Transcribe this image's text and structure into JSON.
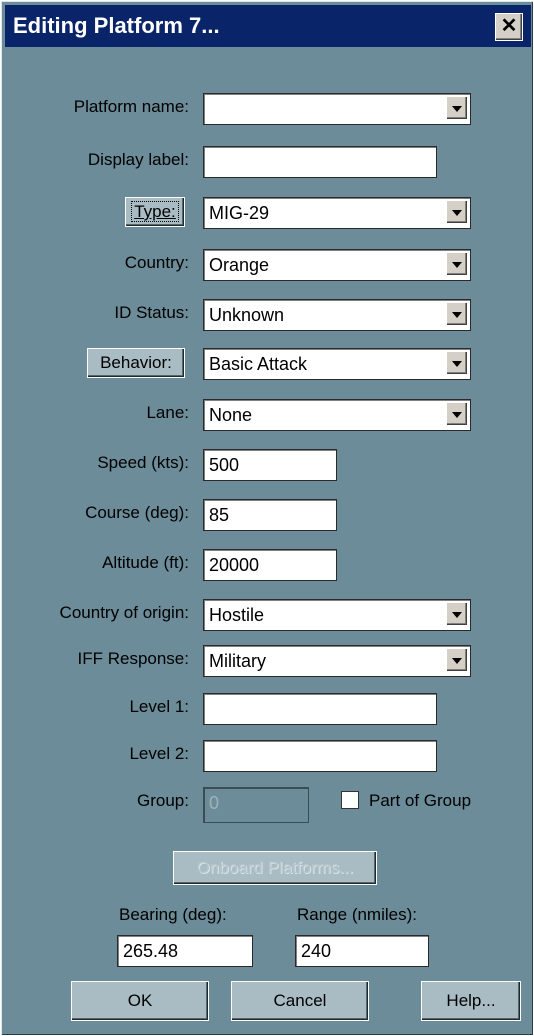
{
  "window": {
    "title": "Editing Platform 7...",
    "close_glyph": "✕"
  },
  "form": {
    "platform_name": {
      "label": "Platform name:",
      "value": ""
    },
    "display_label": {
      "label": "Display label:",
      "value": ""
    },
    "type": {
      "button": "Type:",
      "value": "MIG-29"
    },
    "country": {
      "label": "Country:",
      "value": "Orange"
    },
    "id_status": {
      "label": "ID Status:",
      "value": "Unknown"
    },
    "behavior": {
      "button": "Behavior:",
      "value": "Basic Attack"
    },
    "lane": {
      "label": "Lane:",
      "value": "None"
    },
    "speed": {
      "label": "Speed (kts):",
      "value": "500"
    },
    "course": {
      "label": "Course (deg):",
      "value": "85"
    },
    "altitude": {
      "label": "Altitude (ft):",
      "value": "20000"
    },
    "country_of_origin": {
      "label": "Country of origin:",
      "value": "Hostile"
    },
    "iff_response": {
      "label": "IFF Response:",
      "value": "Military"
    },
    "level1": {
      "label": "Level 1:",
      "value": ""
    },
    "level2": {
      "label": "Level 2:",
      "value": ""
    },
    "group": {
      "label": "Group:",
      "value": "0",
      "part_of_group_label": "Part of Group",
      "part_of_group_checked": false
    },
    "onboard_platforms": {
      "label": "Onboard Platforms..."
    },
    "bearing": {
      "label": "Bearing (deg):",
      "value": "265.48"
    },
    "range": {
      "label": "Range (nmiles):",
      "value": "240"
    }
  },
  "buttons": {
    "ok": "OK",
    "cancel": "Cancel",
    "help": "Help..."
  }
}
